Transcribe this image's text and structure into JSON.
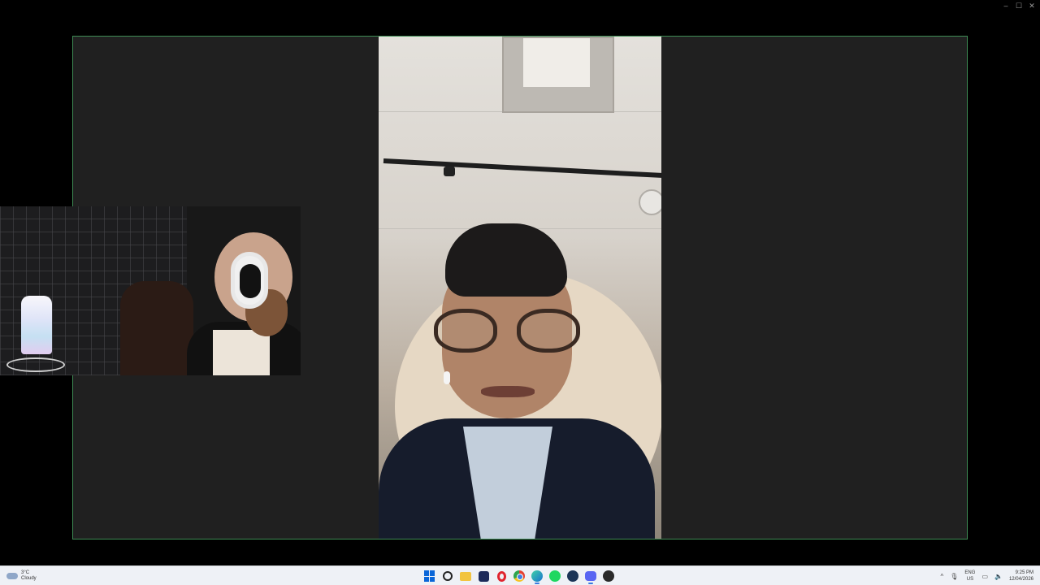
{
  "window": {
    "controls": {
      "minimize": "–",
      "maximize": "☐",
      "close": "✕"
    }
  },
  "taskbar": {
    "weather": {
      "temp": "3°C",
      "condition": "Cloudy",
      "icon": "cloud-icon"
    },
    "apps": [
      {
        "name": "start-icon"
      },
      {
        "name": "search-icon"
      },
      {
        "name": "file-explorer-icon"
      },
      {
        "name": "studio-icon"
      },
      {
        "name": "opera-icon"
      },
      {
        "name": "chrome-icon"
      },
      {
        "name": "edge-icon"
      },
      {
        "name": "spotify-icon"
      },
      {
        "name": "steam-icon"
      },
      {
        "name": "discord-icon"
      },
      {
        "name": "obs-icon"
      }
    ],
    "tray": {
      "chevron": "^",
      "mic": "🎙",
      "lang_primary": "ENG",
      "lang_secondary": "US",
      "network": "▭",
      "volume": "🔈",
      "time": "9:25 PM",
      "date": "12/04/2026"
    }
  },
  "colors": {
    "stage_border": "#3f8d55",
    "stage_bg": "#202020",
    "taskbar_bg": "#eef1f6"
  }
}
